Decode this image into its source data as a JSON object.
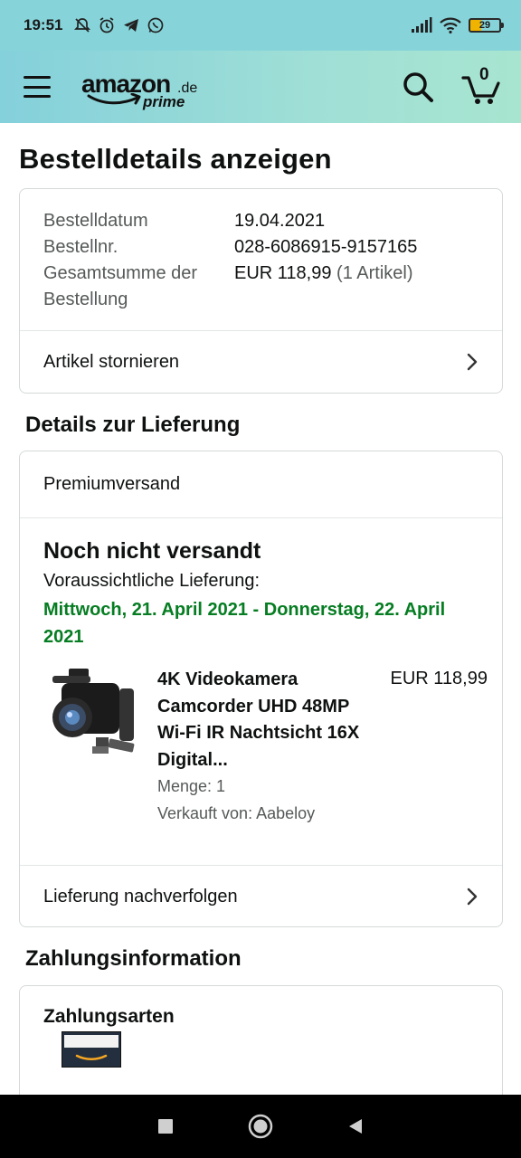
{
  "status_bar": {
    "time": "19:51",
    "battery": "29",
    "icons": [
      "bell-off-icon",
      "alarm-icon",
      "telegram-icon",
      "whatsapp-icon",
      "signal-icon",
      "wifi-icon",
      "battery-icon"
    ]
  },
  "header": {
    "logo_word": "amazon",
    "logo_tld": ".de",
    "logo_prime": "prime",
    "cart_count": "0"
  },
  "page": {
    "title": "Bestelldetails anzeigen"
  },
  "order": {
    "date_label": "Bestelldatum",
    "date_value": "19.04.2021",
    "number_label": "Bestellnr.",
    "number_value": "028-6086915-9157165",
    "total_label": "Gesamtsumme der Bestellung",
    "total_value": "EUR 118,99",
    "total_items": "(1 Artikel)",
    "cancel_label": "Artikel stornieren"
  },
  "delivery": {
    "section_title": "Details zur Lieferung",
    "shipping_method": "Premiumversand",
    "status": "Noch nicht versandt",
    "eta_label": "Voraussichtliche Lieferung:",
    "eta_date": "Mittwoch, 21. April 2021 - Donnerstag, 22. April 2021",
    "product": {
      "title": "4K Videokamera Camcorder UHD 48MP Wi-Fi IR Nachtsicht 16X Digital...",
      "price": "EUR 118,99",
      "quantity": "Menge: 1",
      "seller": "Verkauft von: Aabeloy"
    },
    "track_label": "Lieferung nachverfolgen"
  },
  "payment": {
    "section_title": "Zahlungsinformation",
    "methods_label": "Zahlungsarten"
  },
  "colors": {
    "header_gradient_start": "#84d0db",
    "header_gradient_end": "#a8e5d0",
    "eta_green": "#067d22",
    "muted_text": "#565959",
    "link": "#007185"
  }
}
